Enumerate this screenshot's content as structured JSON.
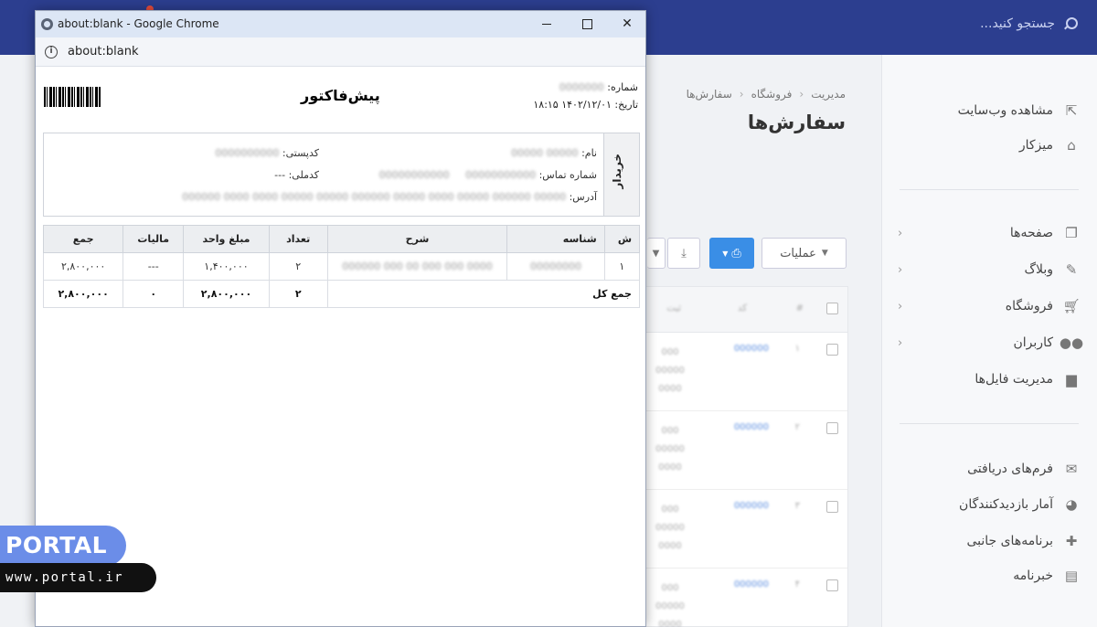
{
  "browser": {
    "window_title": "about:blank - Google Chrome",
    "url": "about:blank"
  },
  "admin": {
    "search_placeholder": "جستجو کنید...",
    "breadcrumb": [
      "مدیریت",
      "فروشگاه",
      "سفارش‌ها"
    ],
    "page_title": "سفارش‌ها",
    "operations_label": "عملیات",
    "sidebar": {
      "items_top": [
        {
          "label": "مشاهده وب‌سایت",
          "icon": "external-link-icon"
        },
        {
          "label": "میزکار",
          "icon": "home-icon"
        }
      ],
      "items_mid": [
        {
          "label": "صفحه‌ها",
          "icon": "pages-icon"
        },
        {
          "label": "وبلاگ",
          "icon": "pencil-icon"
        },
        {
          "label": "فروشگاه",
          "icon": "cart-icon"
        },
        {
          "label": "کاربران",
          "icon": "users-icon"
        },
        {
          "label": "مدیریت فایل‌ها",
          "icon": "folder-icon"
        }
      ],
      "items_bottom": [
        {
          "label": "فرم‌های دریافتی",
          "icon": "envelope-icon"
        },
        {
          "label": "آمار بازدیدکنندگان",
          "icon": "pie-chart-icon"
        },
        {
          "label": "برنامه‌های جانبی",
          "icon": "plug-icon"
        },
        {
          "label": "خبرنامه",
          "icon": "newspaper-icon"
        }
      ]
    }
  },
  "invoice": {
    "title": "پیش‌فاکتور",
    "number_label": "شماره:",
    "date_label": "تاریخ:",
    "date_value": "۱۴۰۲/۱۲/۰۱ ۱۸:۱۵",
    "buyer_section": "خریدار",
    "name_label": "نام:",
    "phone_label": "شماره تماس:",
    "address_label": "آدرس:",
    "postal_label": "کدپستی:",
    "national_label": "کدملی:",
    "national_value": "---",
    "columns": [
      "ش",
      "شناسه",
      "شرح",
      "تعداد",
      "مبلغ واحد",
      "مالیات",
      "جمع"
    ],
    "rows": [
      {
        "index": "۱",
        "quantity": "۲",
        "unit_price": "۱,۴۰۰,۰۰۰",
        "tax": "---",
        "total": "۲,۸۰۰,۰۰۰"
      }
    ],
    "grand_total": {
      "label": "جمع کل",
      "quantity": "۲",
      "unit_price": "۲,۸۰۰,۰۰۰",
      "tax": "۰",
      "total": "۲,۸۰۰,۰۰۰"
    }
  },
  "watermark": {
    "brand": "PORTAL",
    "site": "www.portal.ir"
  }
}
